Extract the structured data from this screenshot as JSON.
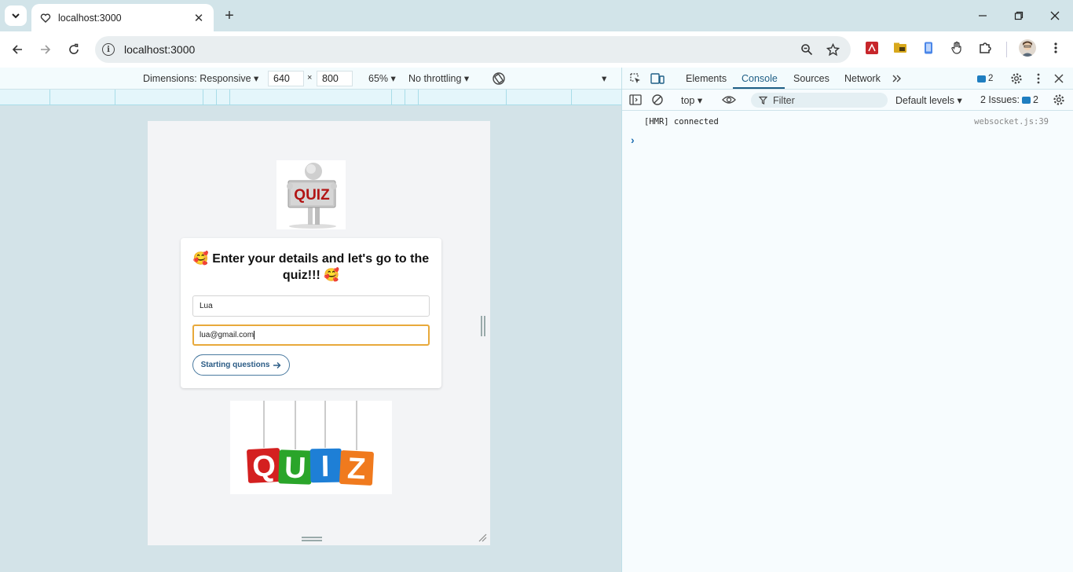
{
  "browser": {
    "tab_title": "localhost:3000",
    "url": "localhost:3000"
  },
  "device_toolbar": {
    "dimensions_label": "Dimensions: Responsive",
    "width": "640",
    "times": "×",
    "height": "800",
    "zoom": "65%",
    "throttling": "No throttling"
  },
  "page": {
    "heading_emoji": "🥰",
    "heading": "Enter your details and let's go to the quiz!!!",
    "name_value": "Lua",
    "email_value": "lua@gmail.com",
    "start_label": "Starting questions",
    "logo_top_text": "QUIZ",
    "logo_bottom_letters": [
      "Q",
      "U",
      "I",
      "Z"
    ],
    "logo_bottom_colors": [
      "#d42020",
      "#2aa52a",
      "#1e7fd6",
      "#f07a1e"
    ]
  },
  "devtools": {
    "tabs": [
      "Elements",
      "Console",
      "Sources",
      "Network"
    ],
    "active_tab": "Console",
    "message_count": "2",
    "context": "top",
    "filter_placeholder": "Filter",
    "levels": "Default levels",
    "issues_label": "2 Issues:",
    "issues_count": "2",
    "log_message": "[HMR] connected",
    "log_source": "websocket.js:39",
    "prompt_symbol": "›"
  }
}
